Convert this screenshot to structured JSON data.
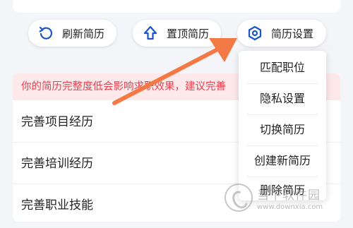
{
  "actions": {
    "refresh_label": "刷新简历",
    "pin_label": "置顶简历",
    "settings_label": "简历设置"
  },
  "banner": {
    "text": "你的简历完整度低会影响求职效果，建议完善"
  },
  "list": {
    "items": [
      {
        "label": "完善项目经历"
      },
      {
        "label": "完善培训经历"
      },
      {
        "label": "完善职业技能"
      }
    ]
  },
  "settings_menu": {
    "items": [
      {
        "label": "匹配职位"
      },
      {
        "label": "隐私设置"
      },
      {
        "label": "切换简历"
      },
      {
        "label": "创建新简历"
      },
      {
        "label": "删除简历"
      }
    ]
  },
  "watermark": {
    "title": "当下软件园",
    "url": "www.downxia.com"
  },
  "colors": {
    "accent": "#1a56c7",
    "annotation_arrow": "#f47a45",
    "banner_bg": "#fde8ea",
    "banner_text": "#e8414f"
  },
  "icons": {
    "refresh": "refresh-icon",
    "pin": "pin-top-icon",
    "settings": "settings-hexagon-icon"
  }
}
